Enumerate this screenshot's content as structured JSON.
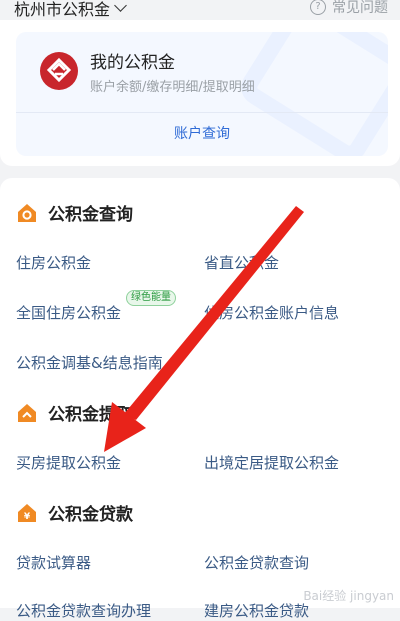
{
  "header": {
    "city": "杭州市公积金",
    "faq": "常见问题",
    "faq_icon": "?"
  },
  "fund_card": {
    "title": "我的公积金",
    "subtitle": "账户余额/缴存明细/提取明细",
    "button": "账户查询"
  },
  "sections": [
    {
      "title": "公积金查询",
      "items": [
        "住房公积金",
        "省直公积金",
        "全国住房公积金",
        "住房公积金账户信息",
        "公积金调基&结息指南"
      ],
      "badge": "绿色能量"
    },
    {
      "title": "公积金提取",
      "items": [
        "买房提取公积金",
        "出境定居提取公积金"
      ]
    },
    {
      "title": "公积金贷款",
      "items": [
        "贷款试算器",
        "公积金贷款查询",
        "公积金贷款查询办理",
        "建房公积金贷款"
      ]
    }
  ],
  "watermark": "Bai经验 jingyan",
  "colors": {
    "accent_blue": "#2f6bd6",
    "link_text": "#3a5a85",
    "arrow_red": "#e8231a",
    "icon_orange": "#f08a24"
  }
}
